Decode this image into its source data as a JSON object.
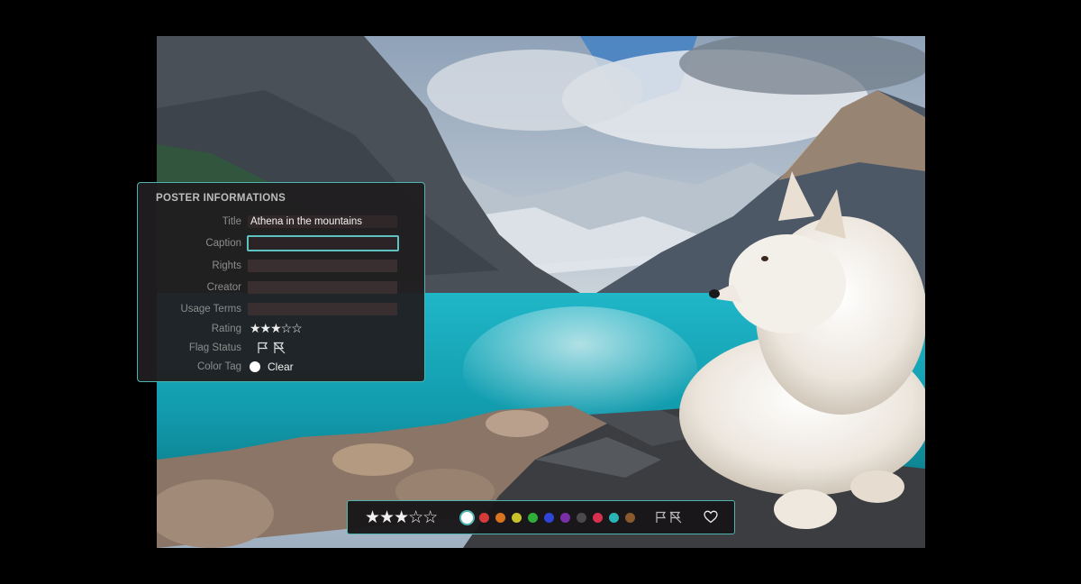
{
  "panel": {
    "title": "POSTER INFORMATIONS",
    "fields": [
      {
        "label": "Title",
        "value": "Athena in the mountains"
      },
      {
        "label": "Caption",
        "value": ""
      },
      {
        "label": "Rights",
        "value": ""
      },
      {
        "label": "Creator",
        "value": ""
      },
      {
        "label": "Usage Terms",
        "value": ""
      }
    ],
    "rating_label": "Rating",
    "rating_value": 3,
    "rating_max": 5,
    "rating_stars": "★★★☆☆",
    "flag_label": "Flag Status",
    "color_tag_label": "Color Tag",
    "color_tag_value": "Clear"
  },
  "toolbar": {
    "rating_stars": "★★★☆☆",
    "rating_value": 3,
    "colors": [
      "#ffffff",
      "#d63a3a",
      "#d9731f",
      "#c9c32a",
      "#2fae3a",
      "#2f45d6",
      "#7a2fa8",
      "#4a4a4a",
      "#d9304f",
      "#29b5b5",
      "#8a5a2e"
    ],
    "selected_color": "#ffffff",
    "accent": "#4fb3b0"
  }
}
